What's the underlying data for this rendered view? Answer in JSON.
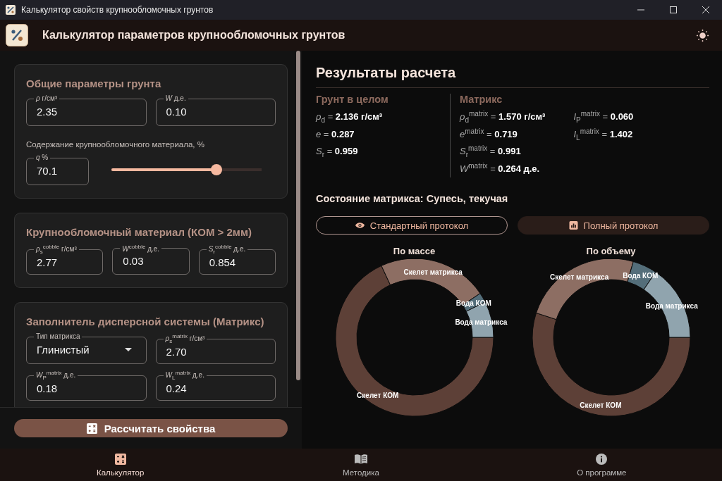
{
  "window": {
    "title": "Калькулятор свойств крупнообломочных грунтов"
  },
  "header": {
    "title": "Калькулятор параметров крупнообломочных грунтов"
  },
  "input_panel": {
    "sections": [
      {
        "title": "Общие параметры грунта",
        "rows": [
          [
            {
              "kind": "field",
              "label": "*ρ* г/см³",
              "value": "2.35"
            },
            {
              "kind": "field",
              "label": "*W* д.е.",
              "value": "0.10"
            }
          ],
          [
            {
              "kind": "caption",
              "text": "Содержание крупнообломочного материала, %"
            }
          ],
          [
            {
              "kind": "field",
              "label": "*q* %",
              "value": "70.1"
            },
            {
              "kind": "slider",
              "level": 0.701
            }
          ]
        ]
      },
      {
        "title": "Крупнообломочный материал (КОМ > 2мм)",
        "rows": [
          [
            {
              "kind": "field",
              "label": "*ρ*$_{s}$$^{cobble}$ г/см³",
              "value": "2.77"
            },
            {
              "kind": "field",
              "label": "*W*$^{cobble}$ д.е.",
              "value": "0.03"
            },
            {
              "kind": "field",
              "label": "*S*$_{r}$$^{cobble}$ д.е.",
              "value": "0.854"
            }
          ]
        ]
      },
      {
        "title": "Заполнитель дисперсной системы (Матрикс)",
        "rows": [
          [
            {
              "kind": "select",
              "label": "Тип матрикса",
              "value": "Глинистый"
            },
            {
              "kind": "field",
              "label": "*ρ*$_{s}$$^{matrix}$ г/см³",
              "value": "2.70"
            }
          ],
          [
            {
              "kind": "field",
              "label": "*W*$_{P}$$^{matrix}$ д.е.",
              "value": "0.18"
            },
            {
              "kind": "field",
              "label": "*W*$_{L}$$^{matrix}$ д.е.",
              "value": "0.24"
            }
          ]
        ]
      }
    ],
    "calculate_button": {
      "label": "Рассчитать свойства"
    }
  },
  "results": {
    "title": "Результаты расчета",
    "columns": [
      {
        "title": "Грунт в целом",
        "groups": [
          [
            "*ρ*$_{d}$ = **2.136 г/см³**",
            "*e* = **0.287**",
            "*S*$_{r}$ = **0.959**"
          ]
        ]
      },
      {
        "title": "Матрикс",
        "groups": [
          [
            "*ρ*$_{d}$$^{matrix}$ = **1.570 г/см³**",
            "*e*$^{matrix}$ = **0.719**",
            "*S*$_{r}$$^{matrix}$ = **0.991**",
            "*W*$^{matrix}$ = **0.264 д.е.**"
          ],
          [
            "*I*$_{P}$$^{matrix}$ = **0.060**",
            "*I*$_{L}$$^{matrix}$ = **1.402**"
          ]
        ]
      }
    ],
    "status": "Состояние матрикса: Супесь, текучая",
    "protocol_buttons": [
      {
        "kind": "outlined",
        "label": "Стандартный протокол"
      },
      {
        "kind": "filled",
        "label": "Полный протокол"
      }
    ],
    "charts": [
      {
        "title": "По массе",
        "segments": [
          {
            "label": "Скелет КОМ",
            "color": "#5d4037"
          },
          {
            "label": "Скелет матрикса",
            "color": "#8d6e63"
          },
          {
            "label": "Вода КОМ",
            "color": "#546e7a"
          },
          {
            "label": "Вода матрикса",
            "color": "#90a4ae"
          }
        ]
      },
      {
        "title": "По объему",
        "segments": [
          {
            "label": "Скелет КОМ",
            "color": "#5d4037"
          },
          {
            "label": "Скелет матрикса",
            "color": "#8d6e63"
          },
          {
            "label": "Вода КОМ",
            "color": "#546e7a"
          },
          {
            "label": "Вода матрикса",
            "color": "#90a4ae"
          }
        ]
      }
    ]
  },
  "nav": [
    {
      "label": "Калькулятор",
      "selected": true
    },
    {
      "label": "Методика",
      "selected": false
    },
    {
      "label": "О программе",
      "selected": false
    }
  ]
}
